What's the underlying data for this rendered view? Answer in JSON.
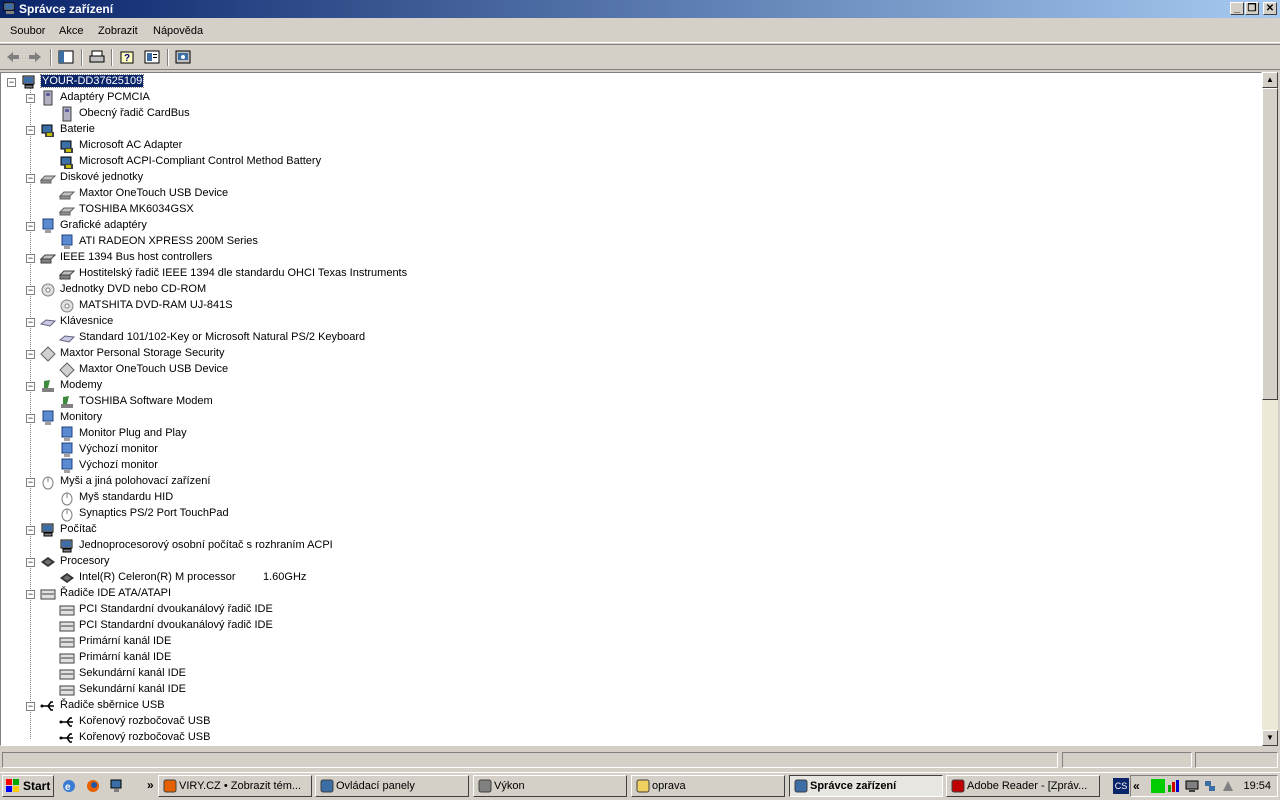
{
  "window": {
    "title": "Správce zařízení"
  },
  "menu": [
    "Soubor",
    "Akce",
    "Zobrazit",
    "Nápověda"
  ],
  "tree": {
    "root": "YOUR-DD37625109",
    "categories": [
      {
        "label": "Adaptéry PCMCIA",
        "icon": "pcmcia-icon",
        "children": [
          "Obecný řadič CardBus"
        ]
      },
      {
        "label": "Baterie",
        "icon": "battery-icon",
        "children": [
          "Microsoft AC Adapter",
          "Microsoft ACPI-Compliant Control Method Battery"
        ]
      },
      {
        "label": "Diskové jednotky",
        "icon": "disk-icon",
        "children": [
          "Maxtor OneTouch USB Device",
          "TOSHIBA MK6034GSX"
        ]
      },
      {
        "label": "Grafické adaptéry",
        "icon": "display-adapter-icon",
        "children": [
          "ATI RADEON XPRESS 200M Series"
        ]
      },
      {
        "label": "IEEE 1394 Bus host controllers",
        "icon": "ieee1394-icon",
        "children": [
          "Hostitelský řadič IEEE 1394 dle standardu OHCI Texas Instruments"
        ]
      },
      {
        "label": "Jednotky DVD nebo CD-ROM",
        "icon": "cdrom-icon",
        "children": [
          "MATSHITA DVD-RAM UJ-841S"
        ]
      },
      {
        "label": "Klávesnice",
        "icon": "keyboard-icon",
        "children": [
          "Standard 101/102-Key or Microsoft Natural PS/2 Keyboard"
        ]
      },
      {
        "label": "Maxtor Personal Storage Security",
        "icon": "storage-security-icon",
        "children": [
          "Maxtor OneTouch USB Device"
        ]
      },
      {
        "label": "Modemy",
        "icon": "modem-icon",
        "children": [
          "TOSHIBA Software Modem"
        ]
      },
      {
        "label": "Monitory",
        "icon": "monitor-icon",
        "children": [
          "Monitor Plug and Play",
          "Výchozí monitor",
          "Výchozí monitor"
        ]
      },
      {
        "label": "Myši a jiná polohovací zařízení",
        "icon": "mouse-icon",
        "children": [
          "Myš standardu HID",
          "Synaptics PS/2 Port TouchPad"
        ]
      },
      {
        "label": "Počítač",
        "icon": "computer-icon",
        "children": [
          "Jednoprocesorový osobní počítač s rozhraním ACPI"
        ]
      },
      {
        "label": "Procesory",
        "icon": "processor-icon",
        "children": [
          "Intel(R) Celeron(R) M processor         1.60GHz"
        ]
      },
      {
        "label": "Řadiče IDE ATA/ATAPI",
        "icon": "ide-icon",
        "children": [
          "PCI Standardní dvoukanálový řadič IDE",
          "PCI Standardní dvoukanálový řadič IDE",
          "Primární kanál IDE",
          "Primární kanál IDE",
          "Sekundární kanál IDE",
          "Sekundární kanál IDE"
        ]
      },
      {
        "label": "Řadiče sběrnice USB",
        "icon": "usb-icon",
        "children": [
          "Kořenový rozbočovač USB",
          "Kořenový rozbočovač USB"
        ]
      }
    ]
  },
  "taskbar": {
    "start": "Start",
    "tasks": [
      {
        "label": "VIRY.CZ • Zobrazit tém...",
        "icon": "firefox-icon",
        "active": false
      },
      {
        "label": "Ovládací panely",
        "icon": "control-panel-icon",
        "active": false
      },
      {
        "label": "Výkon",
        "icon": "performance-icon",
        "active": false
      },
      {
        "label": "oprava",
        "icon": "folder-icon",
        "active": false
      },
      {
        "label": "Správce zařízení",
        "icon": "device-manager-icon",
        "active": true
      },
      {
        "label": "Adobe Reader - [Zpráv...",
        "icon": "adobe-reader-icon",
        "active": false
      }
    ],
    "clock": "19:54",
    "overflow": "»",
    "tray_chevron": "«",
    "lang": "CS"
  },
  "colors": {
    "title_start": "#0a246a",
    "title_end": "#a6caf0",
    "face": "#d4d0c8",
    "selection": "#0a246a"
  }
}
